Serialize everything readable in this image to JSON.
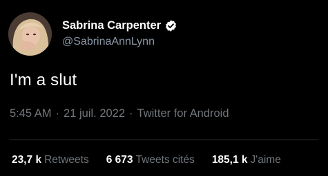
{
  "author": {
    "display_name": "Sabrina Carpenter",
    "handle": "@SabrinaAnnLynn",
    "verified_icon": "verified-badge-icon",
    "avatar_icon": "profile-photo"
  },
  "tweet": {
    "text": "I'm a slut"
  },
  "meta": {
    "time": "5:45 AM",
    "separator": "·",
    "date": "21 juil. 2022",
    "source": "Twitter for Android"
  },
  "stats": {
    "retweets": {
      "count": "23,7 k",
      "label": "Retweets"
    },
    "quotes": {
      "count": "6 673",
      "label": "Tweets cités"
    },
    "likes": {
      "count": "185,1 k",
      "label": "J'aime"
    }
  },
  "colors": {
    "background": "#000000",
    "primary_text": "#ffffff",
    "secondary_text": "#71767b",
    "divider": "#2f3336",
    "badge": "#ffffff"
  }
}
